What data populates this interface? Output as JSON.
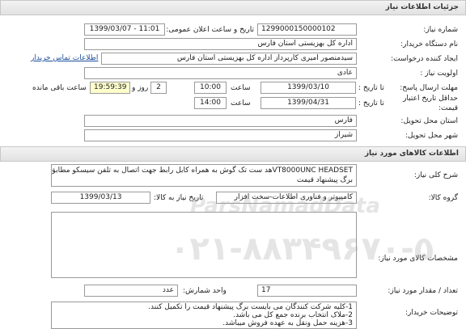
{
  "header": {
    "title": "جزئیات اطلاعات نیاز"
  },
  "fields": {
    "need_number_label": "شماره نیاز:",
    "need_number": "1299000150000102",
    "announce_datetime_label": "تاریخ و ساعت اعلان عمومی:",
    "announce_datetime": "1399/03/07 - 11:01",
    "buyer_org_label": "نام دستگاه خریدار:",
    "buyer_org": "اداره کل بهزیستی استان فارس",
    "creator_label": "ایجاد کننده درخواست:",
    "creator": "سیدمنصور امیری کارپرداز اداره کل بهزیستی استان فارس",
    "contact_link": "اطلاعات تماس خریدار",
    "priority_label": "اولویت نیاز :",
    "priority": "عادی",
    "deadline_label": "مهلت ارسال پاسخ:",
    "deadline_until": "تا تاریخ :",
    "deadline_date": "1399/03/10",
    "time_label": "ساعت",
    "deadline_time": "10:00",
    "days_count": "2",
    "days_label": "روز و",
    "remaining_time": "19:59:39",
    "remaining_label": "ساعت باقی مانده",
    "validity_label_1": "حداقل تاریخ اعتبار",
    "validity_label_2": "قیمت:",
    "validity_until": "تا تاریخ :",
    "validity_date": "1399/04/31",
    "validity_time_label": "ساعت",
    "validity_time": "14:00",
    "province_label": "استان محل تحویل:",
    "province": "فارس",
    "city_label": "شهر محل تحویل:",
    "city": "شیراز"
  },
  "goods": {
    "section_title": "اطلاعات کالاهای مورد نیاز",
    "description_label": "شرح کلی نیاز:",
    "description_line1": "VT8000UNC HEADSETهد ست تک گوش به همراه کابل رابط جهت اتصال به تلفن  سیسکو مطابق با",
    "description_line2": "برگ پیشنهاد قیمت",
    "group_label": "گروه کالا:",
    "group_value": "کامپیوتر و فناوری اطلاعات-سخت افزار",
    "need_date_label": "تاریخ نیاز به کالا:",
    "need_date": "1399/03/13",
    "specs_label": "مشخصات کالای مورد نیاز:",
    "qty_label": "تعداد / مقدار مورد نیاز:",
    "qty": "17",
    "unit_label": "واحد شمارش:",
    "unit": "عدد",
    "notes_label": "توضیحات خریدار:",
    "notes": [
      "1-کلیه شرکت کنندگان می بایست برگ پیشنهاد قیمت را تکمیل کنند.",
      "2-ملاک انتخاب برنده جمع کل می باشد.",
      "3-هزینه حمل ونقل به عهده فروش میباشد."
    ]
  },
  "watermark": {
    "site": "ParsNamadData",
    "phone": "۰۲۱-۸۸۳۴۹۶۷۰-۵"
  },
  "colors": {
    "header_bg": "#e6e6e6",
    "highlight": "#ffffcc",
    "link": "#1a4d9c"
  }
}
